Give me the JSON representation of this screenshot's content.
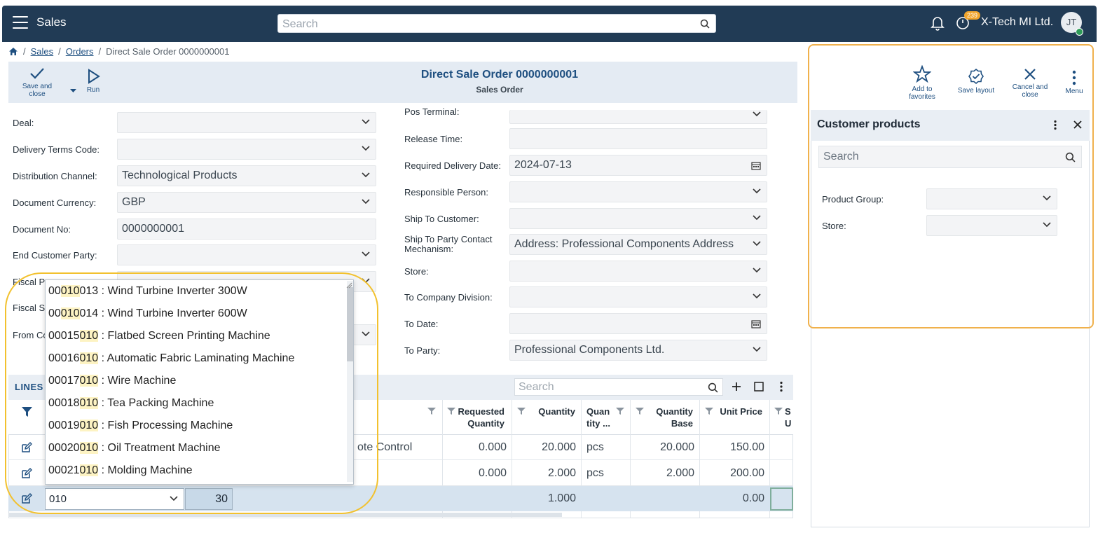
{
  "header": {
    "app_title": "Sales",
    "search_placeholder": "Search",
    "timer_badge": "239",
    "company": "X-Tech MI Ltd.",
    "avatar_initials": "JT"
  },
  "breadcrumb": {
    "items": [
      "Sales",
      "Orders",
      "Direct Sale Order 0000000001"
    ]
  },
  "toolbar": {
    "save_close": "Save and close",
    "run": "Run",
    "title": "Direct Sale Order 0000000001",
    "subtitle": "Sales Order",
    "add_favorites": "Add to favorites",
    "save_layout": "Save layout",
    "cancel_close": "Cancel and close",
    "menu": "Menu"
  },
  "form_left": [
    {
      "label": "Deal:",
      "value": ""
    },
    {
      "label": "Delivery Terms Code:",
      "value": ""
    },
    {
      "label": "Distribution Channel:",
      "value": "Technological Products"
    },
    {
      "label": "Document Currency:",
      "value": "GBP"
    },
    {
      "label": "Document No:",
      "value": "0000000001"
    },
    {
      "label": "End Customer Party:",
      "value": ""
    },
    {
      "label": "Fiscal Pr",
      "value": ""
    },
    {
      "label": "Fiscal Sa",
      "value": ""
    },
    {
      "label": "From Co",
      "value": ""
    }
  ],
  "form_right": [
    {
      "label": "Pos Terminal:",
      "value": ""
    },
    {
      "label": "Release Time:",
      "value": ""
    },
    {
      "label": "Required Delivery Date:",
      "value": "2024-07-13"
    },
    {
      "label": "Responsible Person:",
      "value": ""
    },
    {
      "label": "Ship To Customer:",
      "value": ""
    },
    {
      "label": "Ship To Party Contact Mechanism:",
      "value": "Address: Professional Components Address"
    },
    {
      "label": "Store:",
      "value": ""
    },
    {
      "label": "To Company Division:",
      "value": ""
    },
    {
      "label": "To Date:",
      "value": ""
    },
    {
      "label": "To Party:",
      "value": "Professional Components Ltd."
    }
  ],
  "lines": {
    "title": "LINES",
    "search_placeholder": "Search",
    "columns": {
      "requested_quantity": "Requested Quantity",
      "quantity": "Quantity",
      "quantity_unit": "Quan tity ...",
      "quantity_base": "Quantity Base",
      "unit_price": "Unit Price",
      "partial": "S U"
    },
    "rows": [
      {
        "product_tail": "ote Control",
        "requested": "0.000",
        "quantity": "20.000",
        "unit": "pcs",
        "base": "20.000",
        "price": "150.00"
      },
      {
        "product_tail": "",
        "requested": "0.000",
        "quantity": "2.000",
        "unit": "pcs",
        "base": "2.000",
        "price": "200.00"
      },
      {
        "product_input": "010",
        "line_no": "30",
        "requested": "",
        "quantity": "1.000",
        "unit": "",
        "base": "",
        "price": "0.00"
      }
    ]
  },
  "dropdown": {
    "items": [
      {
        "pre": "00",
        "hl": "010",
        "post": "013 : Wind Turbine Inverter 300W"
      },
      {
        "pre": "00",
        "hl": "010",
        "post": "014 : Wind Turbine Inverter 600W"
      },
      {
        "pre": "00015",
        "hl": "010",
        "post": " : Flatbed Screen Printing Machine"
      },
      {
        "pre": "00016",
        "hl": "010",
        "post": " : Automatic Fabric Laminating Machine"
      },
      {
        "pre": "00017",
        "hl": "010",
        "post": " : Wire Machine"
      },
      {
        "pre": "00018",
        "hl": "010",
        "post": " : Tea Packing Machine"
      },
      {
        "pre": "00019",
        "hl": "010",
        "post": " : Fish Processing Machine"
      },
      {
        "pre": "00020",
        "hl": "010",
        "post": " : Oil Treatment Machine"
      },
      {
        "pre": "00021",
        "hl": "010",
        "post": " : Molding Machine"
      }
    ]
  },
  "panel": {
    "title": "Customer products",
    "search_placeholder": "Search",
    "product_group_label": "Product Group:",
    "store_label": "Store:"
  },
  "colors": {
    "header_bg": "#213b55",
    "accent": "#1e4f80",
    "highlight_outline": "#f2c12e",
    "match_highlight": "#fdf3c3"
  }
}
